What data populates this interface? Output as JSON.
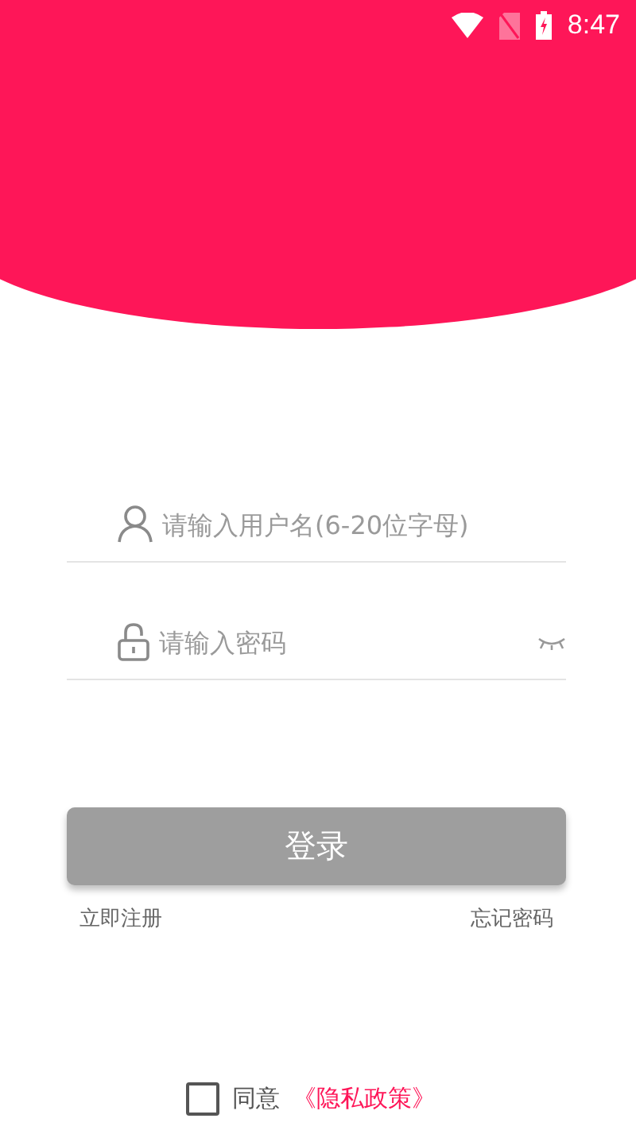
{
  "status_bar": {
    "time": "8:47"
  },
  "login_form": {
    "username": {
      "placeholder": "请输入用户名(6-20位字母)"
    },
    "password": {
      "placeholder": "请输入密码"
    },
    "login_button": "登录",
    "register_link": "立即注册",
    "forgot_link": "忘记密码"
  },
  "agreement": {
    "checked": false,
    "label": "同意",
    "policy_link": "《隐私政策》"
  }
}
